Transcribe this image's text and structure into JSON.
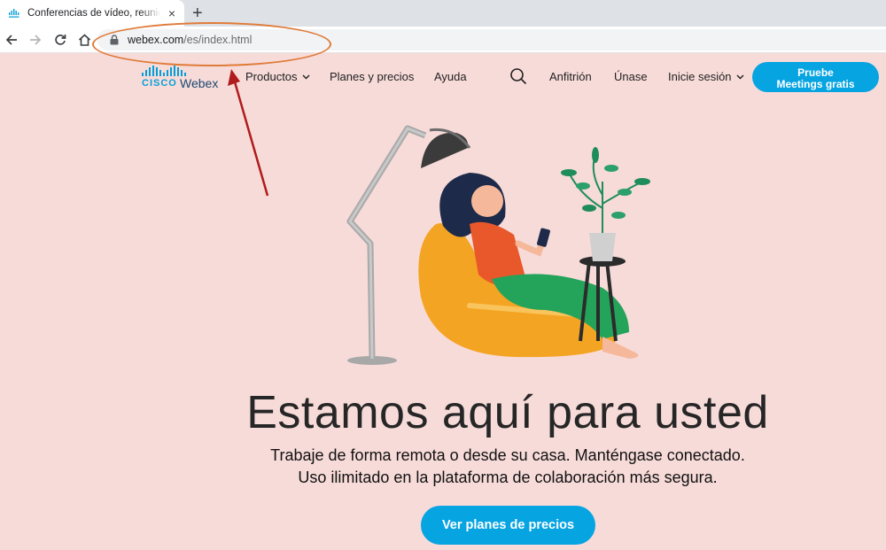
{
  "browser": {
    "tab_title": "Conferencias de vídeo, reuniones en línea",
    "tab_close": "×",
    "new_tab": "+",
    "url_host": "webex.com",
    "url_path": "/es/index.html"
  },
  "site_nav": {
    "logo_cisco": "CISCO",
    "logo_webex": "Webex",
    "items": [
      {
        "label": "Productos",
        "has_dropdown": true
      },
      {
        "label": "Planes y precios",
        "has_dropdown": false
      },
      {
        "label": "Ayuda",
        "has_dropdown": false
      }
    ],
    "right_items": [
      {
        "label": "Anfitrión",
        "has_dropdown": false
      },
      {
        "label": "Únase",
        "has_dropdown": false
      },
      {
        "label": "Inicie sesión",
        "has_dropdown": true
      }
    ],
    "cta_line1": "Pruebe",
    "cta_line2": "Meetings gratis",
    "icons": {
      "search": "search-icon",
      "dropdown": "chevron-down-icon"
    }
  },
  "hero": {
    "title": "Estamos aquí para usted",
    "subtitle_line1": "Trabaje de forma remota o desde su casa. Manténgase conectado.",
    "subtitle_line2": "Uso ilimitado en la plataforma de colaboración más segura.",
    "button_label": "Ver planes de precios"
  },
  "colors": {
    "page_background": "#f7dbd9",
    "brand_blue": "#07a4e2",
    "annotation_ellipse": "#e07b39",
    "annotation_arrow": "#b01c1c"
  }
}
